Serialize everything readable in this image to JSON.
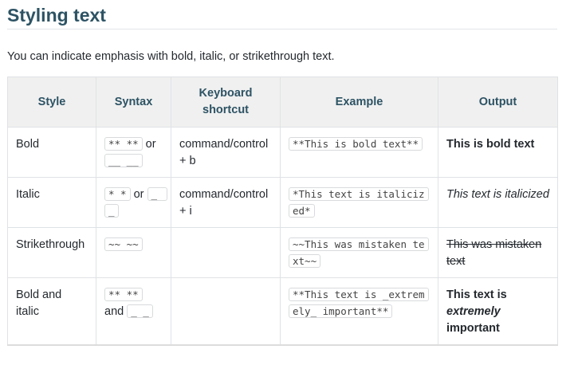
{
  "heading": "Styling text",
  "intro": "You can indicate emphasis with bold, italic, or strikethrough text.",
  "table": {
    "headers": [
      "Style",
      "Syntax",
      "Keyboard shortcut",
      "Example",
      "Output"
    ],
    "rows": [
      {
        "style": "Bold",
        "syntax_code1": "** **",
        "syntax_joiner": "or",
        "syntax_code2": "__ __",
        "shortcut": "command/control + b",
        "example": "**This is bold text**",
        "output": "This is bold text"
      },
      {
        "style": "Italic",
        "syntax_code1": "* *",
        "syntax_joiner": "or",
        "syntax_code2": "_ _",
        "shortcut": "command/control + i",
        "example": "*This text is italicized*",
        "output": "This text is italicized"
      },
      {
        "style": "Strikethrough",
        "syntax_code1": "~~ ~~",
        "shortcut": "",
        "example": "~~This was mistaken text~~",
        "output": "This was mistaken text"
      },
      {
        "style": "Bold and italic",
        "syntax_code1": "** **",
        "syntax_joiner": "and",
        "syntax_code2": "_ _",
        "shortcut": "",
        "example": "**This text is _extremely_ important**",
        "output_pre": "This text is ",
        "output_em": "extremely",
        "output_post": " important"
      }
    ]
  }
}
